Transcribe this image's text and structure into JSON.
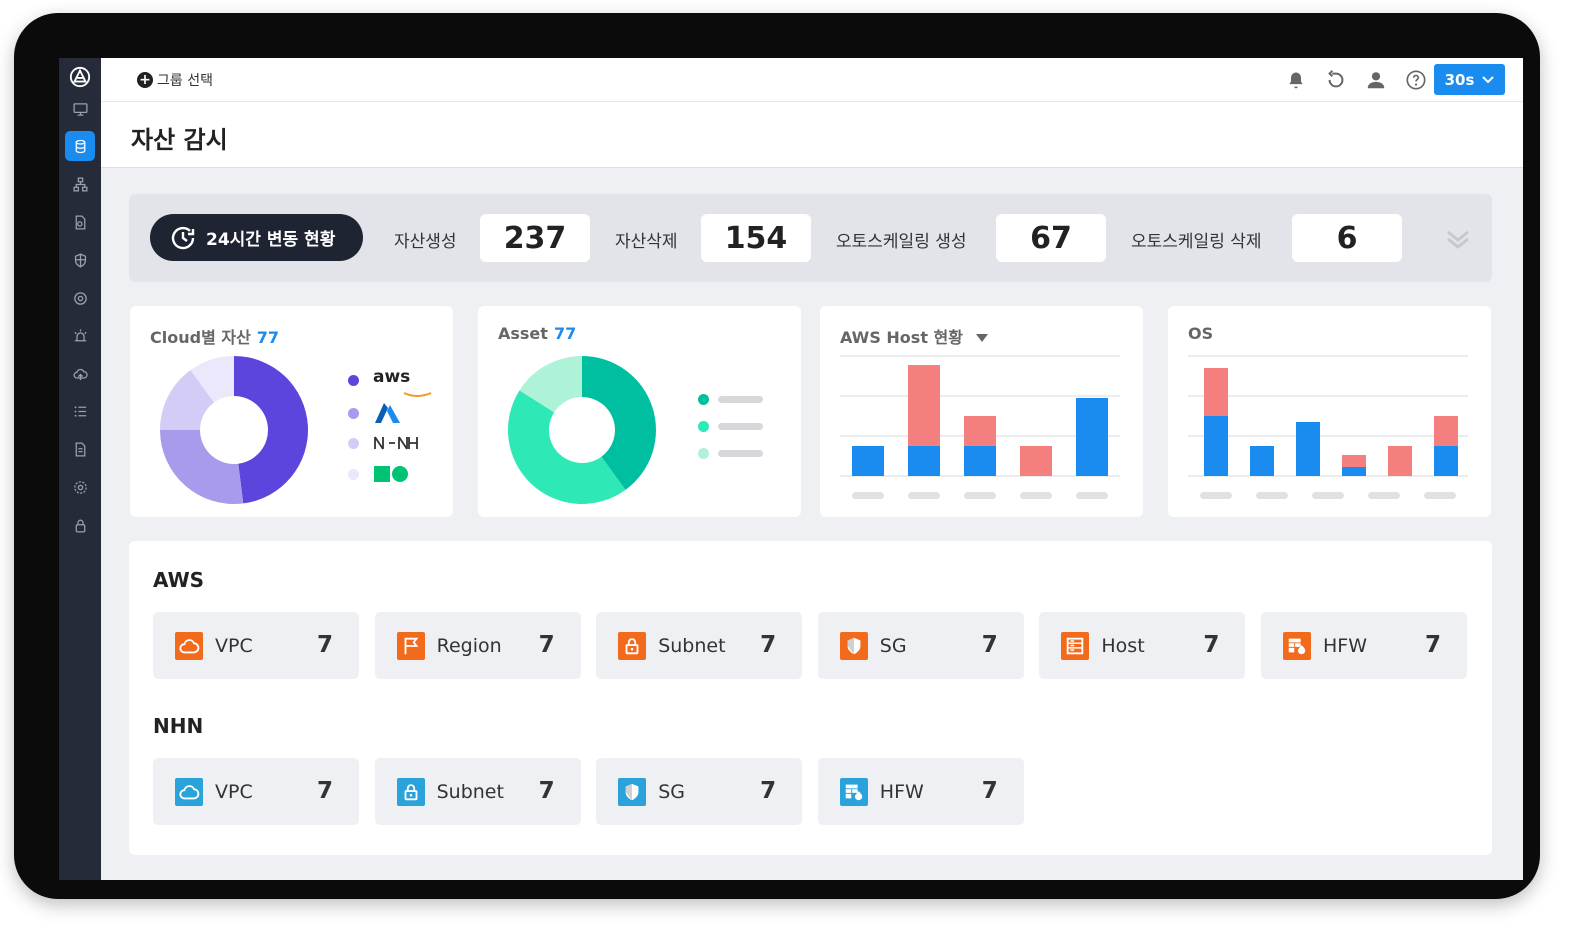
{
  "header": {
    "group_select_label": "그룹 선택",
    "refresh_interval": "30s"
  },
  "page": {
    "title": "자산 감시"
  },
  "summary": {
    "pill_label": "24시간 변동 현황",
    "items": [
      {
        "label": "자산생성",
        "value": "237"
      },
      {
        "label": "자산삭제",
        "value": "154"
      },
      {
        "label": "오토스케일링 생성",
        "value": "67"
      },
      {
        "label": "오토스케일링 삭제",
        "value": "6"
      }
    ]
  },
  "cards": {
    "cloud": {
      "title": "Cloud별 자산",
      "count": "77",
      "legend_text": "aws"
    },
    "asset": {
      "title": "Asset",
      "count": "77"
    },
    "aws_host": {
      "title": "AWS Host 현황"
    },
    "os": {
      "title": "OS"
    }
  },
  "colors": {
    "accent": "#1a8cf0",
    "aws_orange": "#f26b1d",
    "nhn_blue": "#2aa3db",
    "bar_blue": "#1a8cf0",
    "bar_red": "#f47f7f"
  },
  "sections": {
    "aws": {
      "title": "AWS",
      "tiles": [
        {
          "name": "VPC",
          "value": "7",
          "icon": "cloud-icon"
        },
        {
          "name": "Region",
          "value": "7",
          "icon": "flag-icon"
        },
        {
          "name": "Subnet",
          "value": "7",
          "icon": "lock-icon"
        },
        {
          "name": "SG",
          "value": "7",
          "icon": "shield-icon"
        },
        {
          "name": "Host",
          "value": "7",
          "icon": "server-icon"
        },
        {
          "name": "HFW",
          "value": "7",
          "icon": "firewall-icon"
        }
      ]
    },
    "nhn": {
      "title": "NHN",
      "tiles": [
        {
          "name": "VPC",
          "value": "7",
          "icon": "cloud-icon"
        },
        {
          "name": "Subnet",
          "value": "7",
          "icon": "lock-icon"
        },
        {
          "name": "SG",
          "value": "7",
          "icon": "shield-icon"
        },
        {
          "name": "HFW",
          "value": "7",
          "icon": "firewall-icon"
        }
      ]
    }
  },
  "chart_data": [
    {
      "type": "pie",
      "values": [
        48,
        27,
        15,
        10
      ],
      "colors": [
        "#5b45dc",
        "#a99bec",
        "#d2ccf6",
        "#ebe8fb"
      ]
    },
    {
      "type": "pie",
      "values": [
        40,
        44,
        16
      ],
      "colors": [
        "#00bfa0",
        "#2ee8b6",
        "#aef2d8"
      ]
    },
    {
      "type": "bar",
      "categories": [
        "",
        "",
        "",
        "",
        ""
      ],
      "series": [
        {
          "values": [
            1,
            1,
            1,
            0,
            2.6
          ]
        },
        {
          "values": [
            0,
            2.7,
            1,
            1,
            0
          ]
        }
      ],
      "ylim": [
        0,
        4
      ],
      "stacked": true,
      "grid": true
    },
    {
      "type": "bar",
      "categories": [
        "",
        "",
        "",
        "",
        ""
      ],
      "series": [
        {
          "values": [
            2,
            1,
            1.8,
            0.3,
            0,
            1
          ]
        },
        {
          "values": [
            1.6,
            0,
            0,
            0.4,
            1,
            1
          ]
        }
      ],
      "ylim": [
        0,
        4
      ],
      "stacked": true,
      "grid": true
    }
  ]
}
